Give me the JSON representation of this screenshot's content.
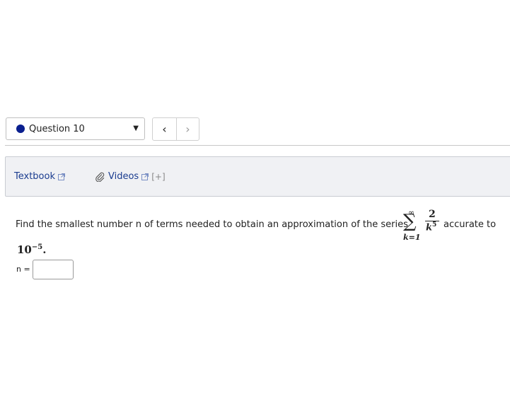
{
  "question_nav": {
    "label": "Question 10",
    "status_color": "#0a1f8f",
    "dropdown_icon": "caret-down-icon",
    "prev_icon": "chevron-left-icon",
    "next_icon": "chevron-right-icon",
    "prev_symbol": "‹",
    "next_symbol": "›"
  },
  "resources": {
    "textbook_label": "Textbook",
    "videos_label": "Videos",
    "expand_label": "[+]",
    "link_color": "#1a3c8f"
  },
  "question": {
    "prefix": "Find the smallest number n of terms needed to obtain an approximation of the series",
    "sum_upper": "∞",
    "sum_symbol": "∑",
    "sum_lower": "k=1",
    "numerator": "2",
    "denominator_base": "k",
    "denominator_exp": "5",
    "suffix": "accurate to",
    "power_base": "10",
    "power_exp": "−5",
    "power_end": "."
  },
  "answer": {
    "label": "n =",
    "value": ""
  }
}
